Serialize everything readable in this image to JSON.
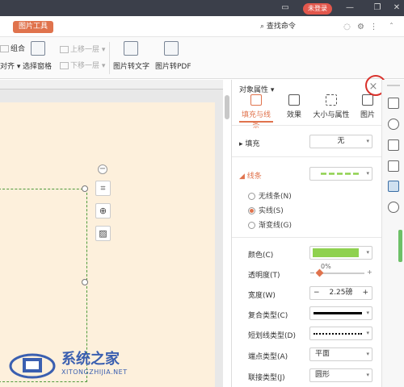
{
  "titlebar": {
    "login_label": "未登录"
  },
  "tabs": {
    "picture_tools": "图片工具",
    "search_command": "查找命令"
  },
  "ribbon": {
    "combine": "组合",
    "align": "对齐",
    "selection_pane": "选择窗格",
    "bring_forward": "上移一层",
    "send_backward": "下移一层",
    "pic_to_text": "图片转文字",
    "pic_to_pdf": "图片转PDF"
  },
  "panel": {
    "title": "对象属性",
    "tabs": [
      "填充与线条",
      "效果",
      "大小与属性",
      "图片"
    ],
    "fill": {
      "label": "填充",
      "value": "无"
    },
    "line": {
      "label": "线条"
    },
    "line_options": [
      "无线条(N)",
      "实线(S)",
      "渐变线(G)"
    ],
    "line_selected": 1,
    "props": {
      "color": "颜色(C)",
      "transparency": "透明度(T)",
      "transparency_value": "0%",
      "width": "宽度(W)",
      "width_value": "2.25磅",
      "compound": "复合类型(C)",
      "dash": "短划线类型(D)",
      "cap": "端点类型(A)",
      "cap_value": "平面",
      "join": "联接类型(J)",
      "join_value": "圆形"
    }
  },
  "watermark": {
    "brand": "系统之家",
    "url": "XITONGZHIJIA.NET"
  },
  "colors": {
    "accent": "#e0734d",
    "line_green": "#8fd14f",
    "close_ring": "#d9322c"
  }
}
